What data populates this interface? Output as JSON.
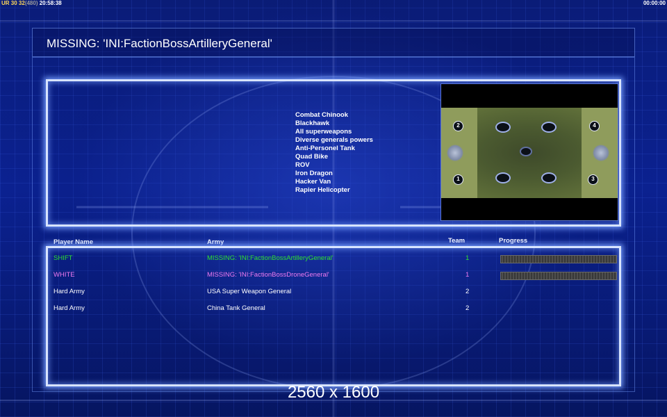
{
  "hud": {
    "left": [
      {
        "text": "UR ",
        "cls": "a"
      },
      {
        "text": "30 ",
        "cls": "a"
      },
      {
        "text": "32",
        "cls": "a"
      },
      {
        "text": "(480)",
        "cls": "b"
      },
      {
        "text": " 20:58:38",
        "cls": "c"
      }
    ],
    "right": "00:00:00"
  },
  "title": "MISSING: 'INI:FactionBossArtilleryGeneral'",
  "units": [
    "Combat Chinook",
    "Blackhawk",
    "All superweapons",
    "Diverse generals powers",
    "Anti-Personel Tank",
    "Quad Bike",
    "ROV",
    "Iron Dragon",
    "Hacker Van",
    "Rapier Helicopter"
  ],
  "minimap": {
    "spawns": [
      "2",
      "4",
      "1",
      "3"
    ]
  },
  "table": {
    "headers": {
      "player": "Player Name",
      "army": "Army",
      "team": "Team",
      "progress": "Progress"
    },
    "rows": [
      {
        "player": "SHIFT",
        "army": "MISSING: 'INI:FactionBossArtilleryGeneral'",
        "team": "1",
        "color": "#2fe02f",
        "progress": 1.0
      },
      {
        "player": "WHITE",
        "army": "MISSING: 'INI:FactionBossDroneGeneral'",
        "team": "1",
        "color": "#f07af0",
        "progress": 1.0
      },
      {
        "player": "Hard Army",
        "army": "USA Super Weapon General",
        "team": "2",
        "color": "#ffffff",
        "progress": null
      },
      {
        "player": "Hard Army",
        "army": "China Tank General",
        "team": "2",
        "color": "#ffffff",
        "progress": null
      }
    ]
  },
  "resolution_label": "2560 x 1600"
}
